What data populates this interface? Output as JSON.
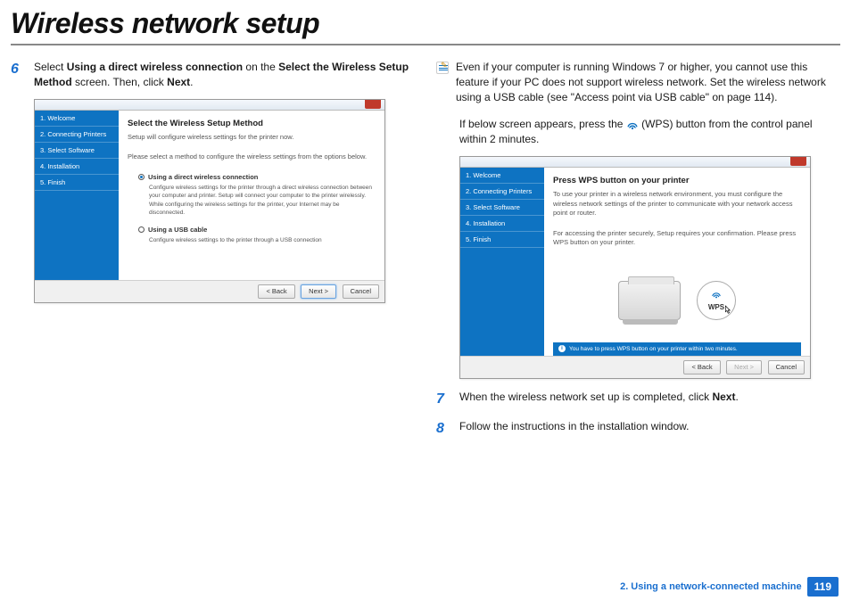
{
  "page": {
    "title": "Wireless network setup",
    "chapter": "2.  Using a network-connected machine",
    "page_number": "119"
  },
  "step6": {
    "num": "6",
    "text_before": "Select ",
    "bold1": "Using a direct wireless connection",
    "text_mid": " on the ",
    "bold2": "Select the Wireless Setup Method",
    "text_after": " screen. Then, click ",
    "bold3": "Next",
    "text_end": "."
  },
  "wiz1": {
    "sidebar": [
      "1. Welcome",
      "2. Connecting Printers",
      "3. Select Software",
      "4. Installation",
      "5. Finish"
    ],
    "heading": "Select the Wireless Setup Method",
    "sub1": "Setup will configure wireless settings for the printer now.",
    "sub2": "Please select a method to configure the wireless settings from the options below.",
    "opt1_label": "Using a direct wireless connection",
    "opt1_desc": "Configure wireless settings for the printer through a direct wireless connection between your computer and printer. Setup will connect your computer to the printer wirelessly. While configuring the wireless settings for the printer, your Internet may be disconnected.",
    "opt2_label": "Using a USB cable",
    "opt2_desc": "Configure wireless settings to the printer through a USB connection",
    "btn_back": "< Back",
    "btn_next": "Next >",
    "btn_cancel": "Cancel"
  },
  "note": {
    "text": "Even if your computer is running Windows 7 or higher, you cannot use this feature if your PC does not support wireless network. Set the wireless network using a USB cable (see \"Access point via USB cable\" on page 114)."
  },
  "para1": {
    "before": "If below screen appears, press the ",
    "after": " (WPS) button from the control panel within 2 minutes."
  },
  "wiz2": {
    "sidebar": [
      "1. Welcome",
      "2. Connecting Printers",
      "3. Select Software",
      "4. Installation",
      "5. Finish"
    ],
    "heading": "Press WPS button on your printer",
    "sub1": "To use your printer in a wireless network environment, you must configure the wireless network settings of the printer to communicate with your network access point or router.",
    "sub2": "For accessing the printer securely, Setup requires your confirmation. Please press WPS button on your printer.",
    "wps_label": "WPS",
    "infobar": "You have to press WPS button on your printer within two minutes.",
    "btn_back": "< Back",
    "btn_next": "Next >",
    "btn_cancel": "Cancel"
  },
  "step7": {
    "num": "7",
    "text_before": "When the wireless network set up is completed, click ",
    "bold": "Next",
    "text_end": "."
  },
  "step8": {
    "num": "8",
    "text": "Follow the instructions in the installation window."
  }
}
